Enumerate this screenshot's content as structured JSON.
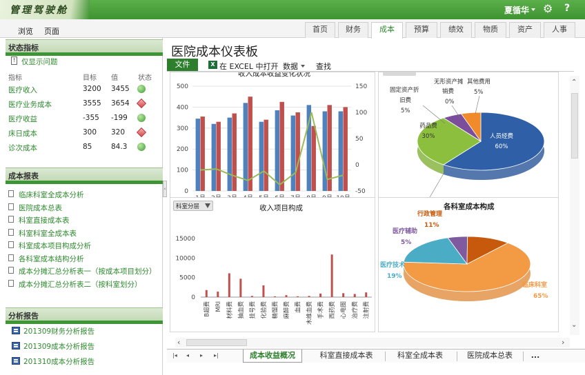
{
  "app": {
    "logo": "管理驾驶舱",
    "user": "夏循华"
  },
  "nav": {
    "links": [
      "浏览",
      "页面"
    ],
    "tabs": [
      "首页",
      "财务",
      "成本",
      "预算",
      "绩效",
      "物质",
      "资产",
      "人事"
    ],
    "active_tab": "成本"
  },
  "sidebar": {
    "status": {
      "title": "状态指标",
      "show_issues": "仅显示问题",
      "headers": {
        "name": "指标",
        "target": "目标",
        "value": "值",
        "status": "状态"
      },
      "rows": [
        {
          "name": "医疗收入",
          "target": "3200",
          "value": "3455",
          "status": "good"
        },
        {
          "name": "医疗业务成本",
          "target": "3555",
          "value": "3654",
          "status": "bad"
        },
        {
          "name": "医疗收益",
          "target": "-355",
          "value": "-199",
          "status": "good"
        },
        {
          "name": "床日成本",
          "target": "300",
          "value": "320",
          "status": "bad"
        },
        {
          "name": "诊次成本",
          "target": "85",
          "value": "84.3",
          "status": "good"
        }
      ]
    },
    "reports": {
      "title": "成本报表",
      "items": [
        "临床科室全成本分析",
        "医院成本总表",
        "科室直接成本表",
        "科室科室全成本表",
        "科室成本项目构成分析",
        "各科室成本结构分析",
        "成本分摊汇总分析表一（按成本项目划分）",
        "成本分摊汇总分析表二（按科室划分）"
      ]
    },
    "analysis": {
      "title": "分析报告",
      "items": [
        "201309财务分析报告",
        "201309成本分析报告",
        "201310成本分析报告"
      ]
    }
  },
  "main": {
    "title": "医院成本仪表板",
    "ribbon": {
      "file": "文件",
      "excel_badge": "X",
      "excel": "在 EXCEL 中打开",
      "data": "数据",
      "find": "查找"
    },
    "sheets": [
      "成本收益概况",
      "科室直接成本表",
      "科室全成本表",
      "医院成本总表"
    ],
    "active_sheet": "成本收益概况",
    "more": "..."
  },
  "chart_data": [
    {
      "type": "bar",
      "title": "收入成本收益变化状况",
      "categories": [
        "1月",
        "2月",
        "3月",
        "4月",
        "5月",
        "6月",
        "7月",
        "8月",
        "9月",
        "10月"
      ],
      "series": [
        {
          "name": "收入",
          "type": "bar",
          "axis": "left",
          "color": "#4f81bd",
          "values": [
            345,
            320,
            350,
            420,
            330,
            385,
            360,
            410,
            380,
            380
          ]
        },
        {
          "name": "成本",
          "type": "bar",
          "axis": "left",
          "color": "#c0504d",
          "values": [
            355,
            330,
            370,
            450,
            340,
            425,
            375,
            310,
            410,
            400
          ]
        },
        {
          "name": "收益",
          "type": "line",
          "axis": "right",
          "color": "#9bbb59",
          "values": [
            -10,
            -8,
            -20,
            -30,
            -12,
            -38,
            -15,
            100,
            -28,
            -20
          ]
        }
      ],
      "yticks_left": [
        "0",
        "100",
        "200",
        "300",
        "400",
        "500"
      ],
      "yticks_right": [
        "-50",
        "0",
        "50",
        "100",
        "150"
      ],
      "ylim": [
        0,
        500
      ],
      "ylim_right": [
        -50,
        150
      ]
    },
    {
      "type": "pie",
      "title": "",
      "slices": [
        {
          "label": "人员经费",
          "pct": "60%",
          "value": 60,
          "color": "#2f5fa7"
        },
        {
          "label": "卫生材料",
          "pct": "0%",
          "value": 0,
          "color": "#9ab64a"
        },
        {
          "label": "药品费",
          "pct": "30%",
          "value": 30,
          "color": "#8cbf3e"
        },
        {
          "label": "固定资产折旧费",
          "pct": "5%",
          "value": 5,
          "color": "#7a4e9a"
        },
        {
          "label": "无形资产摊销费",
          "pct": "0%",
          "value": 0,
          "color": "#3fa8c0"
        },
        {
          "label": "其他费用",
          "pct": "5%",
          "value": 5,
          "color": "#f08a2a"
        }
      ]
    },
    {
      "type": "bar",
      "title": "收入项目构成",
      "filter_label": "科室分层",
      "categories": [
        "B超费",
        "MRI",
        "材料费",
        "抽血费",
        "挂号费",
        "化验费",
        "精馏费",
        "麻醉费",
        "血费",
        "木维血费",
        "手术费",
        "西药费",
        "心电图",
        "治疗费",
        "注射费"
      ],
      "values": [
        1800,
        1400,
        6100,
        4700,
        300,
        3000,
        200,
        500,
        200,
        300,
        900,
        10900,
        1000,
        800,
        1200
      ],
      "yticks": [
        "0",
        "5000",
        "10000",
        "15000"
      ],
      "ylim": [
        0,
        15000
      ]
    },
    {
      "type": "pie",
      "title": "各科室成本构成",
      "slices": [
        {
          "label": "临床科室",
          "pct": "65%",
          "value": 65,
          "color": "#f39a45"
        },
        {
          "label": "医疗技术",
          "pct": "19%",
          "value": 19,
          "color": "#4bacc6"
        },
        {
          "label": "医疗辅助",
          "pct": "5%",
          "value": 5,
          "color": "#7f5a9e"
        },
        {
          "label": "行政管理",
          "pct": "11%",
          "value": 11,
          "color": "#c6590c"
        }
      ]
    }
  ]
}
